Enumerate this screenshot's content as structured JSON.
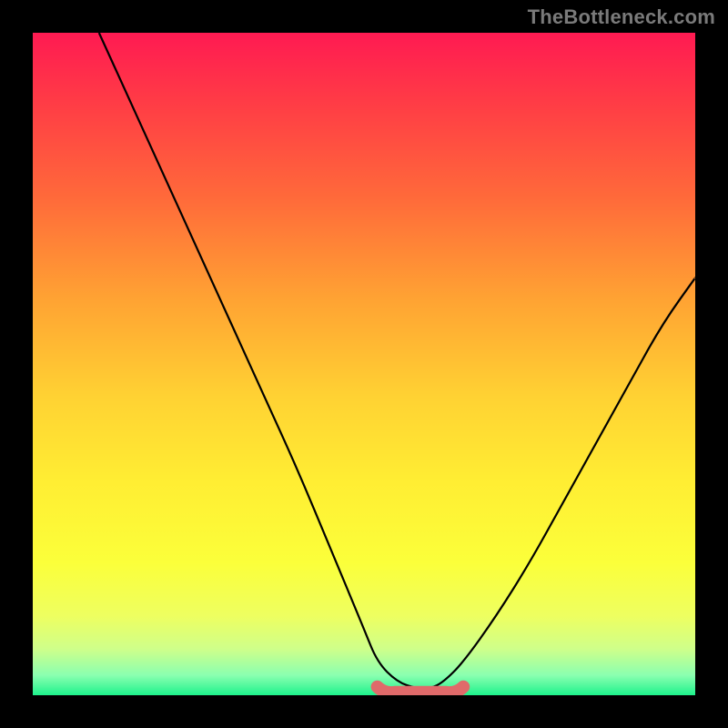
{
  "watermark": "TheBottleneck.com",
  "gradient_colors": {
    "top": "#ff1a52",
    "mid1": "#ffa233",
    "mid2": "#ffee33",
    "bottom": "#1ef28c"
  },
  "curve_color": "#000000",
  "plateau_color": "#e06a6a",
  "frame_color": "#000000",
  "chart_data": {
    "type": "line",
    "title": "",
    "xlabel": "",
    "ylabel": "",
    "xlim": [
      0,
      100
    ],
    "ylim": [
      0,
      100
    ],
    "series": [
      {
        "name": "bottleneck-curve",
        "x": [
          10,
          15,
          20,
          25,
          30,
          35,
          40,
          45,
          50,
          52,
          55,
          58,
          60,
          62,
          65,
          70,
          75,
          80,
          85,
          90,
          95,
          100
        ],
        "y": [
          100,
          89,
          78,
          67,
          56,
          45,
          34,
          22,
          10,
          5,
          2,
          1,
          1,
          2,
          5,
          12,
          20,
          29,
          38,
          47,
          56,
          63
        ]
      }
    ],
    "plateau": {
      "x_start": 52,
      "x_end": 65,
      "y": 1,
      "note": "thick coral band marking the near-zero flat region"
    }
  }
}
